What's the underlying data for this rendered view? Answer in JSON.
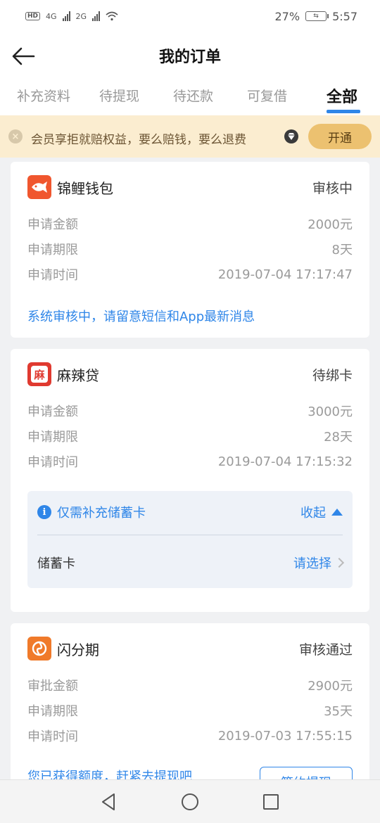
{
  "status_bar": {
    "left": "HD",
    "network1": "4G",
    "network2": "2G",
    "battery": "27%",
    "time": "5:57"
  },
  "header": {
    "title": "我的订单"
  },
  "tabs": [
    {
      "label": "补充资料",
      "active": false
    },
    {
      "label": "待提现",
      "active": false
    },
    {
      "label": "待还款",
      "active": false
    },
    {
      "label": "可复借",
      "active": false
    },
    {
      "label": "全部",
      "active": true
    }
  ],
  "banner": {
    "text": "会员享拒就赔权益，要么赔钱，要么退费",
    "button": "开通"
  },
  "orders": [
    {
      "icon_text": "锦",
      "icon_color": "#f0562e",
      "name": "锦鲤钱包",
      "status": "审核中",
      "rows": [
        {
          "label": "申请金额",
          "value": "2000元"
        },
        {
          "label": "申请期限",
          "value": "8天"
        },
        {
          "label": "申请时间",
          "value": "2019-07-04 17:17:47"
        }
      ],
      "notice": "系统审核中，请留意短信和App最新消息"
    },
    {
      "icon_text": "麻",
      "icon_color": "#e03a30",
      "name": "麻辣贷",
      "status": "待绑卡",
      "rows": [
        {
          "label": "申请金额",
          "value": "3000元"
        },
        {
          "label": "申请期限",
          "value": "28天"
        },
        {
          "label": "申请时间",
          "value": "2019-07-04 17:15:32"
        }
      ],
      "sub": {
        "info": "仅需补充储蓄卡",
        "collapse": "收起",
        "field": "储蓄卡",
        "choose": "请选择"
      }
    },
    {
      "icon_text": "闪",
      "icon_color": "#f07a2a",
      "name": "闪分期",
      "status": "审核通过",
      "rows": [
        {
          "label": "审批金额",
          "value": "2900元"
        },
        {
          "label": "申请期限",
          "value": "35天"
        },
        {
          "label": "申请时间",
          "value": "2019-07-03 17:55:15"
        }
      ],
      "partial_notice": "您已获得额度，赶紧去提现吧",
      "action": "签约提现"
    }
  ]
}
